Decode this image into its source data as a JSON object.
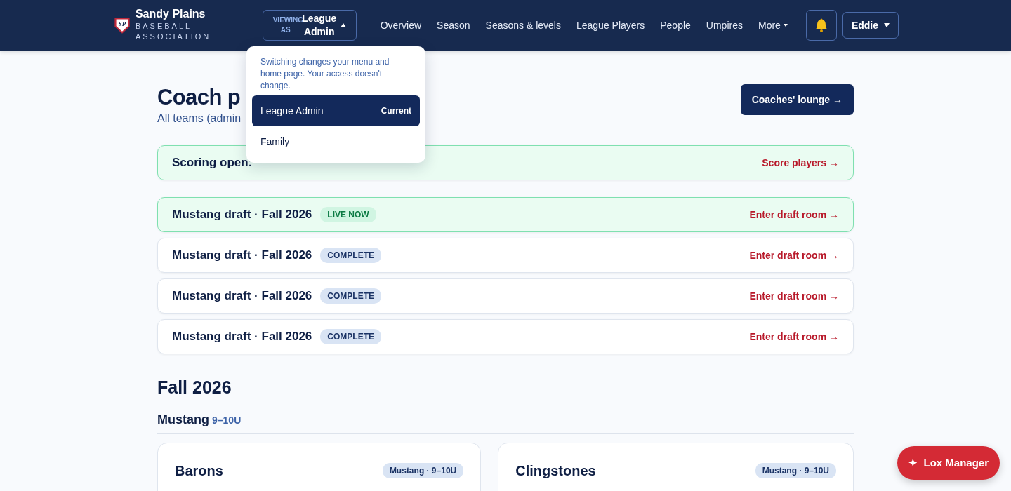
{
  "brand": {
    "logo": "SP",
    "name": "Sandy Plains",
    "sub": "BASEBALL ASSOCIATION"
  },
  "viewing": {
    "label": "VIEWING AS",
    "value": "League Admin",
    "expanded": true
  },
  "nav": [
    {
      "label": "Overview",
      "kind": "link"
    },
    {
      "label": "Season",
      "kind": "link"
    },
    {
      "label": "Seasons & levels",
      "kind": "link"
    },
    {
      "label": "League Players",
      "kind": "link"
    },
    {
      "label": "People",
      "kind": "link"
    },
    {
      "label": "Umpires",
      "kind": "link"
    },
    {
      "label": "More",
      "kind": "dropdown"
    }
  ],
  "user": {
    "name": "Eddie"
  },
  "role_menu": {
    "note": "Switching changes your menu and home page. Your access doesn't change.",
    "items": [
      {
        "label": "League Admin",
        "badge": "Current",
        "selected": true
      },
      {
        "label": "Family",
        "selected": false
      }
    ]
  },
  "page": {
    "title": "Coach p",
    "subtitle": "All teams (admin",
    "action": "Coaches' lounge →"
  },
  "banners": [
    {
      "title": "Scoring open:",
      "kind": "live",
      "link": "Score players →"
    },
    {
      "title": "Mustang draft · Fall 2026",
      "badge": "LIVE NOW",
      "kind": "live",
      "link": "Enter draft room →"
    },
    {
      "title": "Mustang draft · Fall 2026",
      "badge": "COMPLETE",
      "kind": "complete",
      "link": "Enter draft room →"
    },
    {
      "title": "Mustang draft · Fall 2026",
      "badge": "COMPLETE",
      "kind": "complete",
      "link": "Enter draft room →"
    },
    {
      "title": "Mustang draft · Fall 2026",
      "badge": "COMPLETE",
      "kind": "complete",
      "link": "Enter draft room →"
    }
  ],
  "season": {
    "title": "Fall 2026",
    "division": {
      "name": "Mustang",
      "ages": "9–10U"
    },
    "teams": [
      {
        "name": "Barons",
        "tag": "Mustang · 9–10U"
      },
      {
        "name": "Clingstones",
        "tag": "Mustang · 9–10U"
      }
    ]
  },
  "assistant": {
    "icon": "✦",
    "label": "Lox Manager"
  }
}
